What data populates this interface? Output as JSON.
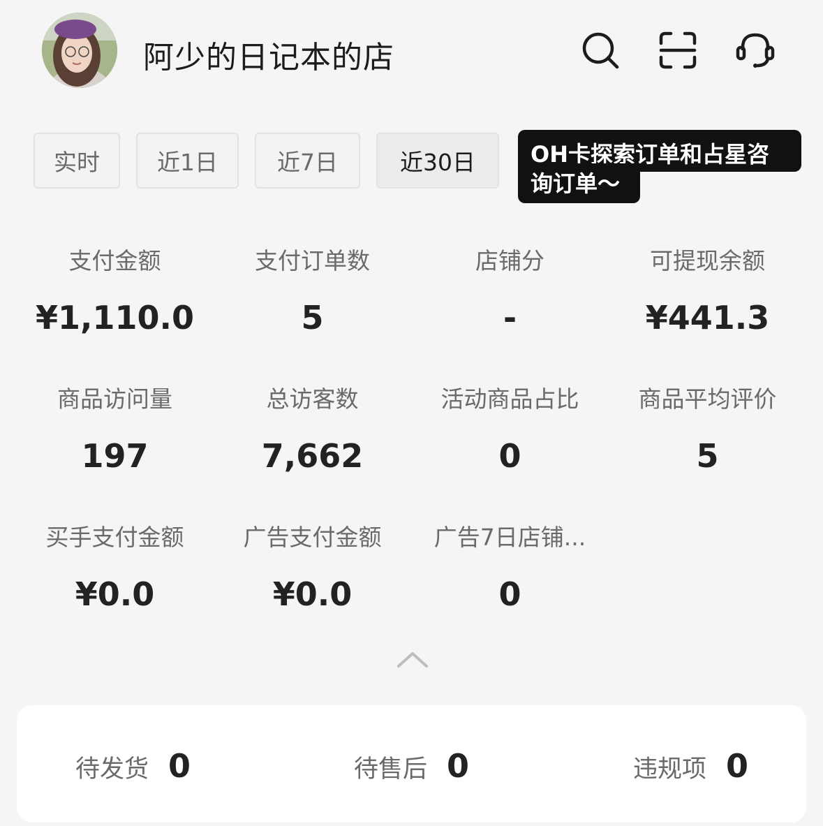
{
  "header": {
    "shop_name": "阿少的日记本的店",
    "icons": [
      "search-icon",
      "scan-icon",
      "customer-service-icon"
    ]
  },
  "time_filters": [
    {
      "label": "实时",
      "active": false
    },
    {
      "label": "近1日",
      "active": false
    },
    {
      "label": "近7日",
      "active": false
    },
    {
      "label": "近30日",
      "active": true
    }
  ],
  "tooltip": {
    "line1": "OH卡探索订单和占星咨",
    "line2": "询订单～"
  },
  "metrics": [
    {
      "label": "支付金额",
      "value": "¥1,110.0"
    },
    {
      "label": "支付订单数",
      "value": "5"
    },
    {
      "label": "店铺分",
      "value": "-"
    },
    {
      "label": "可提现余额",
      "value": "¥441.3"
    },
    {
      "label": "商品访问量",
      "value": "197"
    },
    {
      "label": "总访客数",
      "value": "7,662"
    },
    {
      "label": "活动商品占比",
      "value": "0"
    },
    {
      "label": "商品平均评价",
      "value": "5"
    },
    {
      "label": "买手支付金额",
      "value": "¥0.0"
    },
    {
      "label": "广告支付金额",
      "value": "¥0.0"
    },
    {
      "label": "广告7日店铺...",
      "value": "0"
    }
  ],
  "pending": [
    {
      "label": "待发货",
      "count": "0"
    },
    {
      "label": "待售后",
      "count": "0"
    },
    {
      "label": "违规项",
      "count": "0"
    }
  ]
}
